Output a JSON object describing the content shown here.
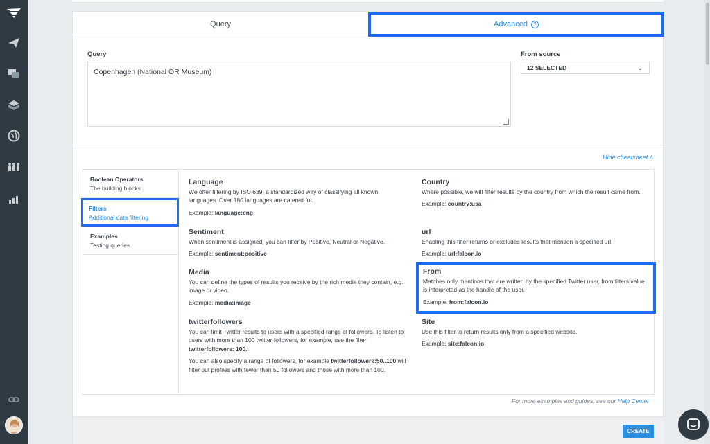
{
  "tabs": {
    "query": "Query",
    "advanced": "Advanced",
    "help_glyph": "?"
  },
  "query": {
    "label": "Query",
    "value": "Copenhagen (National OR Museum)"
  },
  "source": {
    "label": "From source",
    "selected": "12 SELECTED"
  },
  "cheatsheet_toggle": "Hide cheatsheet",
  "nav": [
    {
      "title": "Boolean Operators",
      "subtitle": "The building blocks"
    },
    {
      "title": "Filters",
      "subtitle": "Additional data filtering"
    },
    {
      "title": "Examples",
      "subtitle": "Testing queries"
    }
  ],
  "entries": {
    "language": {
      "title": "Language",
      "desc": "We offer filtering by ISO 639, a standardized way of classifying all known languages. Over 180 languages are catered for.",
      "example_prefix": "Example: ",
      "example": "language:eng"
    },
    "sentiment": {
      "title": "Sentiment",
      "desc": "When sentiment is assigned, you can filter by Positive, Neutral or Negative.",
      "example_prefix": "Example: ",
      "example": "sentiment:positive"
    },
    "media": {
      "title": "Media",
      "desc": "You can define the types of results you receive by the rich media they contain, e.g. image or video.",
      "example_prefix": "Example: ",
      "example": "media:image"
    },
    "twitterfollowers": {
      "title": "twitterfollowers",
      "desc_a": "You can limit Twitter results to users with a specified range of followers. To listen to users with more than 100 twitter followers, for example, use the filter ",
      "desc_a_code": "twitterfollowers: 100..",
      "desc_b_prefix": "You can also specify a range of followers, for example ",
      "desc_b_code": "twitterfollowers:50..100",
      "desc_b_suffix": " will filter out profiles with fewer than 50 followers and those with more than 100."
    },
    "country": {
      "title": "Country",
      "desc": "Where possible, we will filter results by the country from which the result came from.",
      "example_prefix": "Example: ",
      "example": "country:usa"
    },
    "url": {
      "title": "url",
      "desc": "Enabling this filter returns or excludes results that mention a specified url.",
      "example_prefix": "Example: ",
      "example": "url:falcon.io"
    },
    "from": {
      "title": "From",
      "desc": "Matches only mentions that are written by the specified Twitter user, from filters value is interpreted as the handle of the user.",
      "example_prefix": "Example: ",
      "example": "from:falcon.io"
    },
    "site": {
      "title": "Site",
      "desc": "Use this filter to return results only from a specified website.",
      "example_prefix": "Example: ",
      "example": "site:falcon.io"
    }
  },
  "more_help": {
    "text": "For more examples and guides, see our ",
    "link": "Help Center"
  },
  "create_label": "CREATE",
  "colors": {
    "accent": "#2d8fe0",
    "highlight": "#1d6cf5",
    "sidebar": "#2f3a42"
  }
}
